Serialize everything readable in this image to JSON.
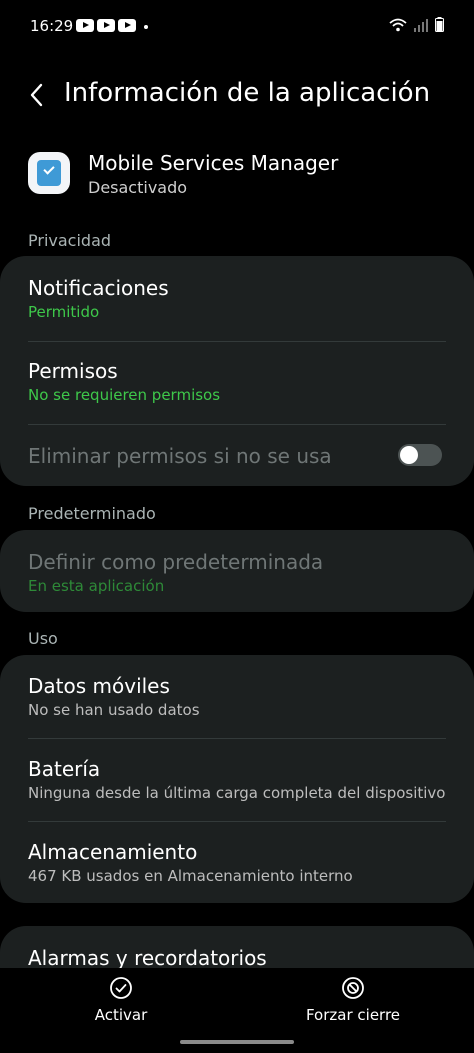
{
  "status_bar": {
    "time": "16:29"
  },
  "header": {
    "title": "Información de la aplicación"
  },
  "app": {
    "name": "Mobile Services Manager",
    "status": "Desactivado"
  },
  "sections": {
    "privacy": {
      "label": "Privacidad",
      "notifications": {
        "title": "Notificaciones",
        "sub": "Permitido"
      },
      "permissions": {
        "title": "Permisos",
        "sub": "No se requieren permisos"
      },
      "remove_permissions": {
        "title": "Eliminar permisos si no se usa",
        "enabled": false
      }
    },
    "default": {
      "label": "Predeterminado",
      "set_default": {
        "title": "Definir como predeterminada",
        "sub": "En esta aplicación"
      }
    },
    "usage": {
      "label": "Uso",
      "mobile_data": {
        "title": "Datos móviles",
        "sub": "No se han usado datos"
      },
      "battery": {
        "title": "Batería",
        "sub": "Ninguna desde la última carga completa del dispositivo"
      },
      "storage": {
        "title": "Almacenamiento",
        "sub": "467 KB usados en Almacenamiento interno"
      }
    },
    "alarms": {
      "title": "Alarmas y recordatorios"
    }
  },
  "bottom_bar": {
    "activate_label": "Activar",
    "force_stop_label": "Forzar cierre"
  },
  "colors": {
    "background": "#000000",
    "card": "#1c2020",
    "accent_green": "#3ec84a"
  },
  "icons": [
    "back-arrow-icon",
    "check-circle-icon",
    "block-icon",
    "wifi-icon",
    "signal-icon",
    "battery-icon",
    "youtube-icon"
  ]
}
